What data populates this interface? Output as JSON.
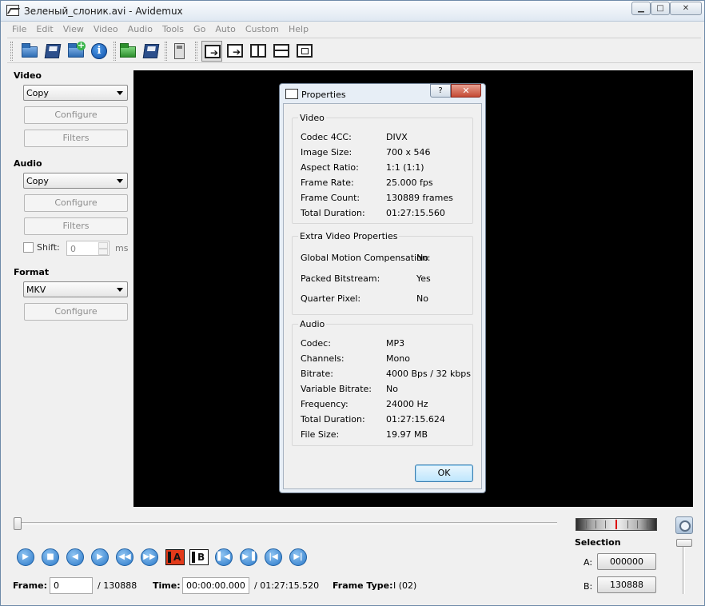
{
  "window": {
    "title": "Зеленый_слоник.avi - Avidemux"
  },
  "menu": [
    "File",
    "Edit",
    "View",
    "Video",
    "Audio",
    "Tools",
    "Go",
    "Auto",
    "Custom",
    "Help"
  ],
  "left_panel": {
    "video": {
      "heading": "Video",
      "codec": "Copy",
      "configure": "Configure",
      "filters": "Filters"
    },
    "audio": {
      "heading": "Audio",
      "codec": "Copy",
      "configure": "Configure",
      "filters": "Filters",
      "shift_label": "Shift:",
      "shift_value": "0",
      "shift_unit": "ms"
    },
    "format": {
      "heading": "Format",
      "container": "MKV",
      "configure": "Configure"
    }
  },
  "properties": {
    "title": "Properties",
    "help_glyph": "?",
    "close_glyph": "✕",
    "video": {
      "title": "Video",
      "rows": [
        {
          "label": "Codec 4CC:",
          "value": "DIVX"
        },
        {
          "label": "Image Size:",
          "value": "700 x 546"
        },
        {
          "label": "Aspect Ratio:",
          "value": "1:1 (1:1)"
        },
        {
          "label": "Frame Rate:",
          "value": "25.000 fps"
        },
        {
          "label": "Frame Count:",
          "value": "130889 frames"
        },
        {
          "label": "Total Duration:",
          "value": "01:27:15.560"
        }
      ]
    },
    "extra": {
      "title": "Extra Video Properties",
      "rows": [
        {
          "label": "Global Motion Compensation:",
          "value": "No"
        },
        {
          "label": "Packed Bitstream:",
          "value": "Yes"
        },
        {
          "label": "Quarter Pixel:",
          "value": "No"
        }
      ]
    },
    "audio": {
      "title": "Audio",
      "rows": [
        {
          "label": "Codec:",
          "value": "MP3"
        },
        {
          "label": "Channels:",
          "value": "Mono"
        },
        {
          "label": "Bitrate:",
          "value": "4000 Bps / 32 kbps"
        },
        {
          "label": "Variable Bitrate:",
          "value": "No"
        },
        {
          "label": "Frequency:",
          "value": "24000 Hz"
        },
        {
          "label": "Total Duration:",
          "value": "01:27:15.624"
        },
        {
          "label": "File Size:",
          "value": "19.97 MB"
        }
      ]
    },
    "ok": "OK"
  },
  "playback": {
    "marker_a": "A",
    "marker_b": "B"
  },
  "selection": {
    "title": "Selection",
    "a_label": "A:",
    "a_value": "000000",
    "b_label": "B:",
    "b_value": "130888"
  },
  "status": {
    "frame_label": "Frame:",
    "frame_value": "0",
    "frame_total": "/ 130888",
    "time_label": "Time:",
    "time_value": "00:00:00.000",
    "time_total": "/ 01:27:15.520",
    "frame_type_label": "Frame Type:",
    "frame_type_value": "I (02)"
  }
}
